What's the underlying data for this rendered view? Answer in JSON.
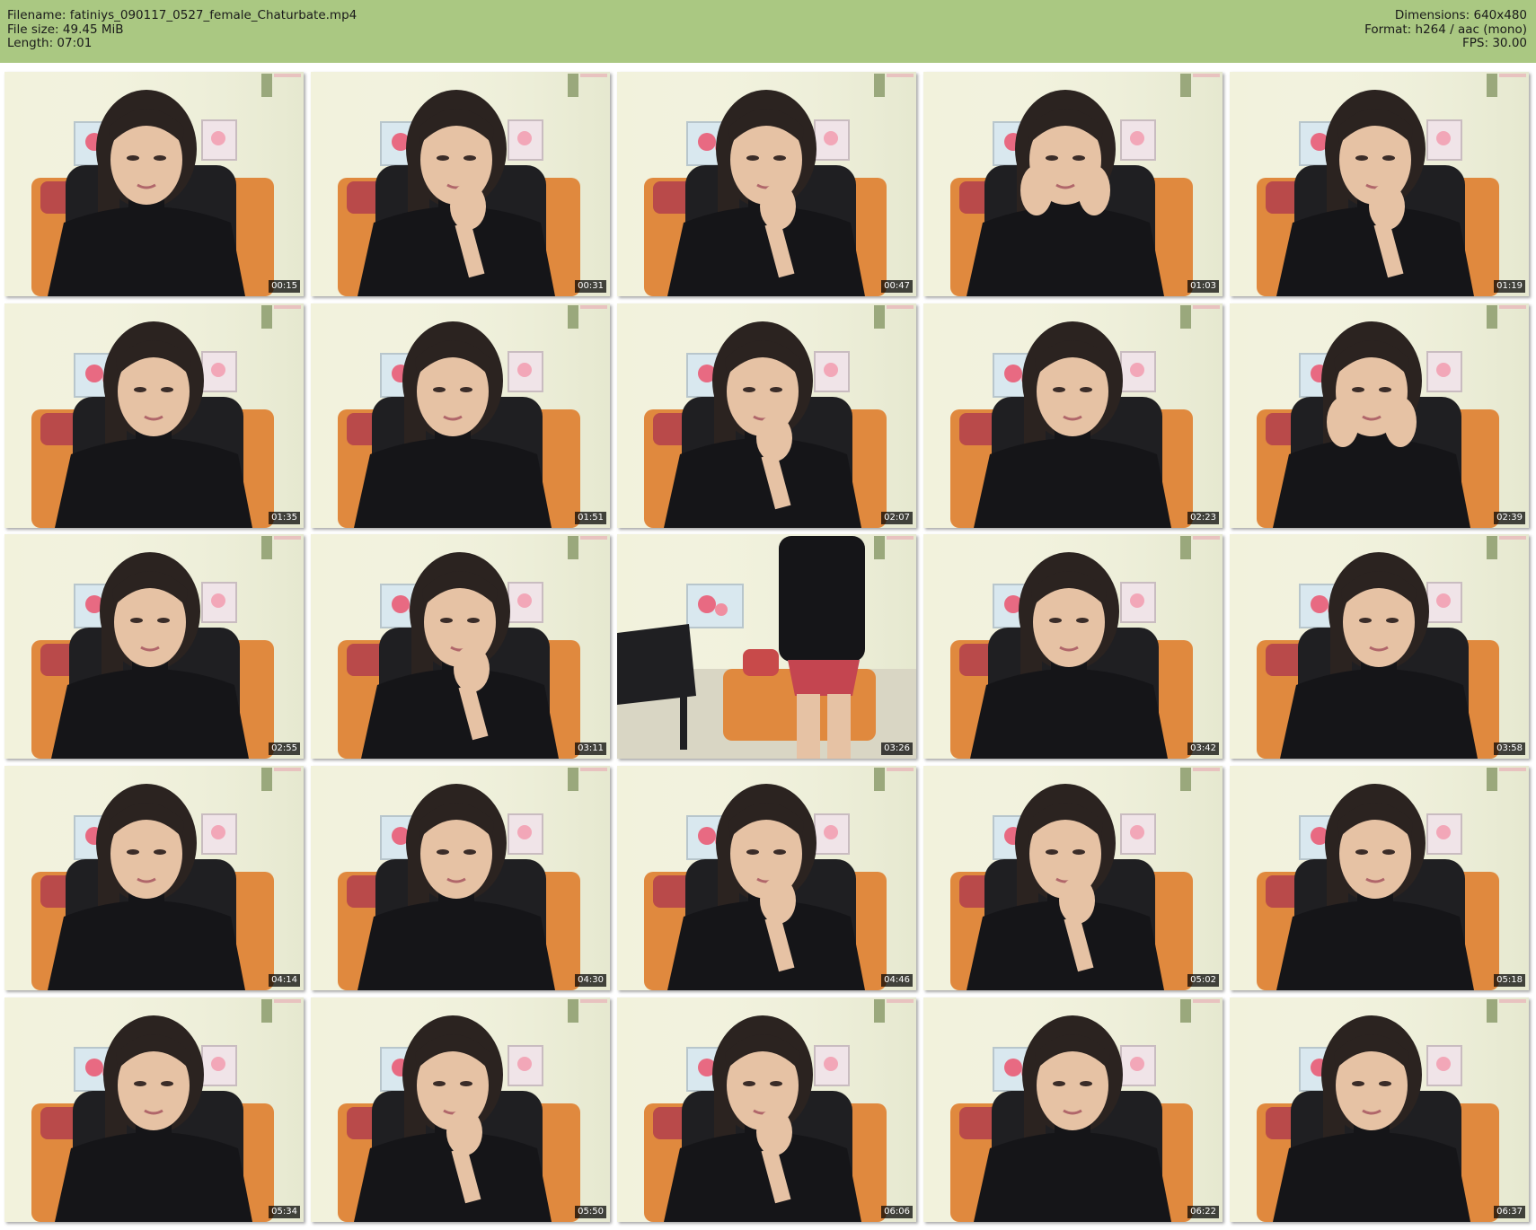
{
  "header": {
    "filename_label": "Filename: fatiniys_090117_0527_female_Chaturbate.mp4",
    "filesize_label": "File size: 49.45 MiB",
    "length_label": "Length: 07:01",
    "dimensions_label": "Dimensions: 640x480",
    "format_label": "Format: h264 / aac (mono)",
    "fps_label": "FPS: 30.00"
  },
  "colors": {
    "header_background": "#aac882",
    "wall": "#f2f2dc",
    "sofa": "#e0893e",
    "chair": "#1f1f22",
    "shirt": "#151518",
    "skin": "#e6c2a4",
    "hair": "#2b2320"
  },
  "thumbnails": [
    {
      "time": "00:15",
      "scene": "portrait"
    },
    {
      "time": "00:31",
      "scene": "portrait-hand"
    },
    {
      "time": "00:47",
      "scene": "portrait-hand"
    },
    {
      "time": "01:03",
      "scene": "portrait-hands"
    },
    {
      "time": "01:19",
      "scene": "portrait-hand"
    },
    {
      "time": "01:35",
      "scene": "portrait"
    },
    {
      "time": "01:51",
      "scene": "portrait"
    },
    {
      "time": "02:07",
      "scene": "portrait-hand"
    },
    {
      "time": "02:23",
      "scene": "portrait"
    },
    {
      "time": "02:39",
      "scene": "portrait-hands"
    },
    {
      "time": "02:55",
      "scene": "portrait"
    },
    {
      "time": "03:11",
      "scene": "portrait-hand"
    },
    {
      "time": "03:26",
      "scene": "standing"
    },
    {
      "time": "03:42",
      "scene": "portrait"
    },
    {
      "time": "03:58",
      "scene": "portrait"
    },
    {
      "time": "04:14",
      "scene": "portrait"
    },
    {
      "time": "04:30",
      "scene": "portrait"
    },
    {
      "time": "04:46",
      "scene": "portrait-hand"
    },
    {
      "time": "05:02",
      "scene": "portrait-hand"
    },
    {
      "time": "05:18",
      "scene": "portrait"
    },
    {
      "time": "05:34",
      "scene": "portrait"
    },
    {
      "time": "05:50",
      "scene": "portrait-hand"
    },
    {
      "time": "06:06",
      "scene": "portrait-hand"
    },
    {
      "time": "06:22",
      "scene": "portrait"
    },
    {
      "time": "06:37",
      "scene": "portrait"
    }
  ]
}
